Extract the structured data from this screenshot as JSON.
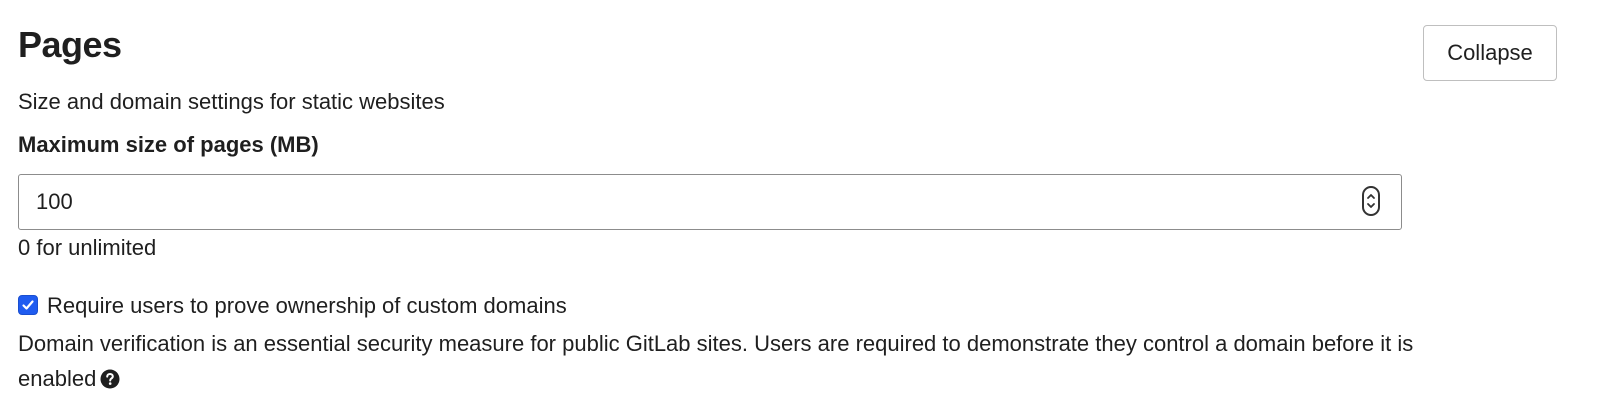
{
  "section": {
    "title": "Pages",
    "description": "Size and domain settings for static websites",
    "collapse_label": "Collapse"
  },
  "max_size": {
    "label": "Maximum size of pages (MB)",
    "value": "100",
    "help": "0 for unlimited",
    "stepper_icon": "number-stepper-icon"
  },
  "domain_verification": {
    "checked": true,
    "label": "Require users to prove ownership of custom domains",
    "help": "Domain verification is an essential security measure for public GitLab sites. Users are required to demonstrate they control a domain before it is enabled",
    "help_icon": "question-circle-icon"
  },
  "colors": {
    "checkbox_accent": "#1f5cf0",
    "text": "#1f1f1f",
    "input_border": "#8c8c8c",
    "button_border": "#bfbfbf"
  }
}
